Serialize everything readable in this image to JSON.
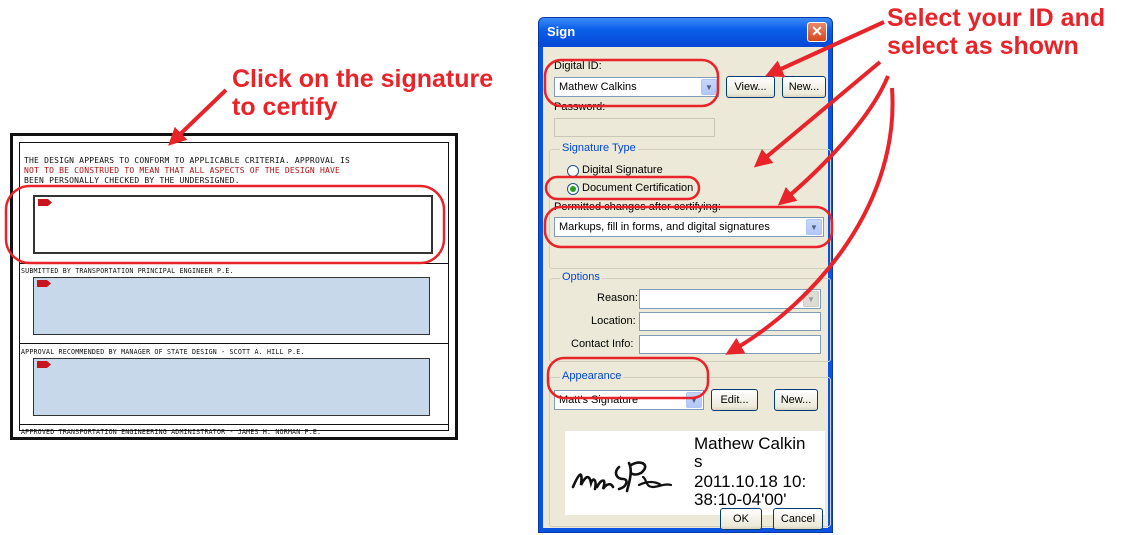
{
  "callouts": {
    "left_line1": "Click on the signature",
    "left_line2": "to certify",
    "right_line1": "Select your ID and",
    "right_line2": "select as shown"
  },
  "document": {
    "line1": "THE DESIGN APPEARS TO CONFORM TO APPLICABLE CRITERIA. APPROVAL IS",
    "line2": "NOT TO BE CONSTRUED TO MEAN THAT ALL ASPECTS OF THE DESIGN HAVE",
    "line3": "BEEN PERSONALLY CHECKED BY THE UNDERSIGNED.",
    "submitted_by": "SUBMITTED BY TRANSPORTATION PRINCIPAL ENGINEER P.E.",
    "recommended_by": "APPROVAL RECOMMENDED BY MANAGER OF STATE DESIGN - SCOTT A. HILL P.E.",
    "approved_by": "APPROVED TRANSPORTATION ENGINEERING ADMINISTRATOR - JAMES H. NORMAN P.E."
  },
  "dialog": {
    "title": "Sign",
    "close_glyph": "✕",
    "digital_id_label": "Digital ID:",
    "digital_id_value": "Mathew Calkins",
    "view_button": "View...",
    "new_button": "New...",
    "password_label": "Password:",
    "signature_type_label": "Signature Type",
    "radio_digital_signature": "Digital Signature",
    "radio_document_certification": "Document Certification",
    "permitted_changes_label": "Permitted changes after certifying:",
    "permitted_changes_value": "Markups, fill in forms, and digital signatures",
    "options_label": "Options",
    "reason_label": "Reason:",
    "location_label": "Location:",
    "contact_label": "Contact Info:",
    "appearance_label": "Appearance",
    "appearance_value": "Matt's Signature",
    "edit_button": "Edit...",
    "appearance_new_button": "New...",
    "preview_name_line1": "Mathew Calkin",
    "preview_name_line2": "s",
    "preview_date_line1": "2011.10.18 10:",
    "preview_date_line2": "38:10-04'00'",
    "ok_button": "OK",
    "cancel_button": "Cancel",
    "selected_radio": "Document Certification"
  },
  "colors": {
    "callout_red": "#e8242a",
    "xp_title_blue": "#0a52e0",
    "dialog_face": "#ece9d8",
    "signature_field_blue": "#c7d8ea"
  }
}
